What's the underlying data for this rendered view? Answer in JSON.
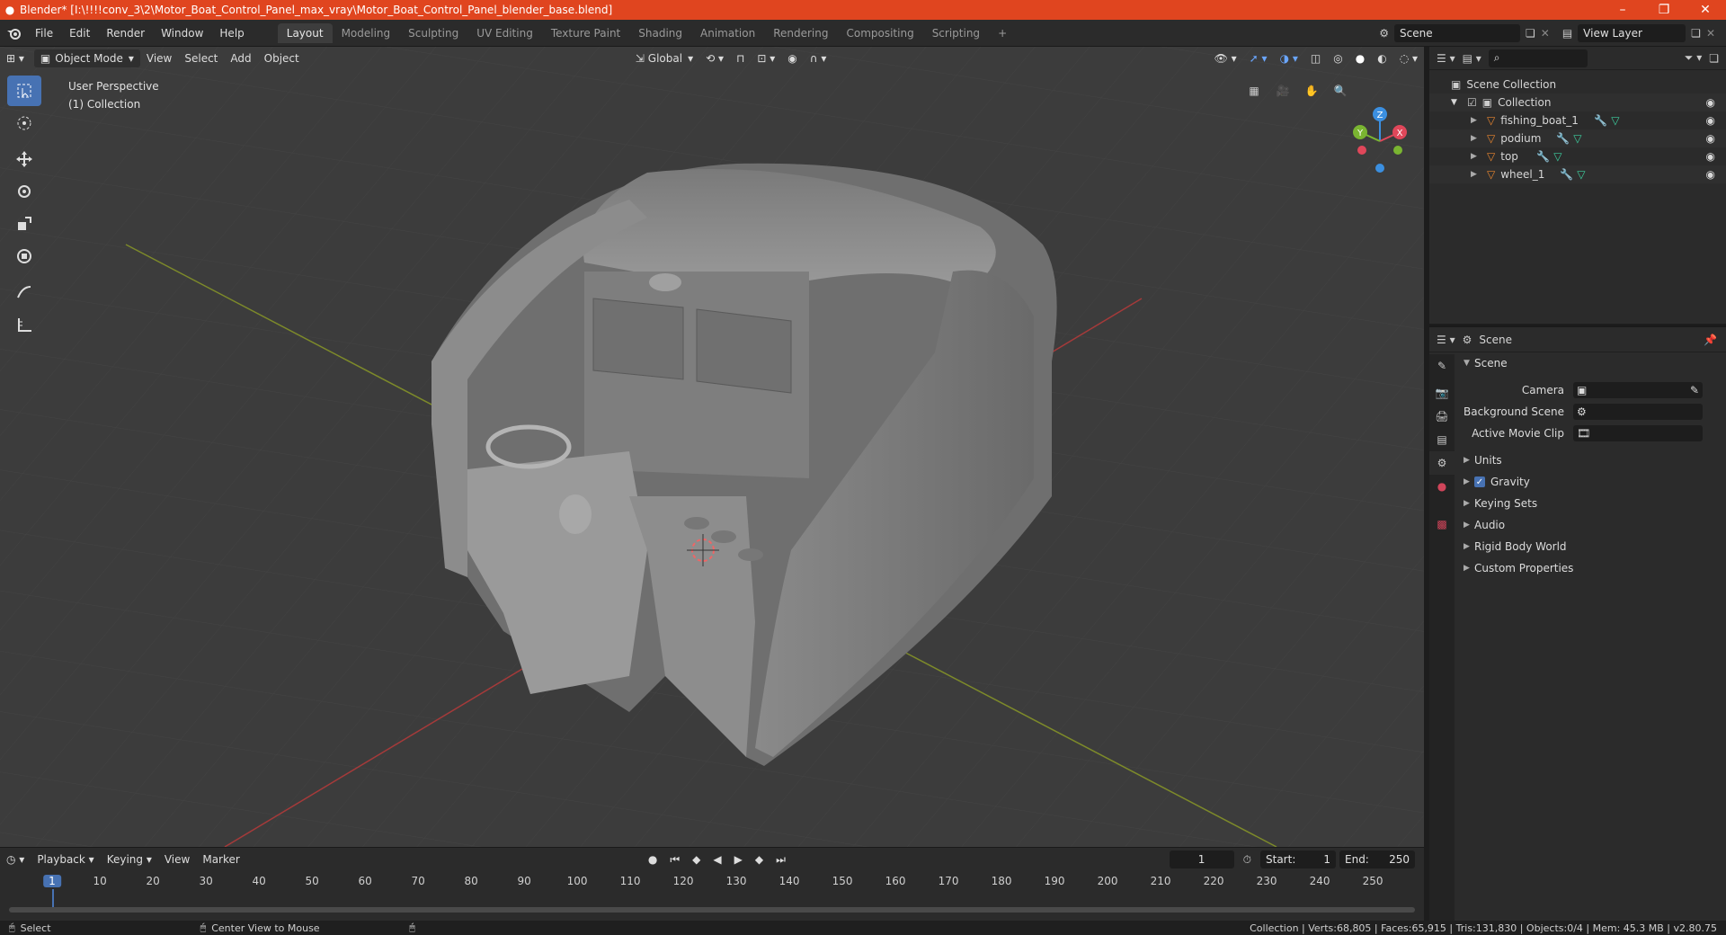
{
  "window": {
    "title": "Blender* [I:\\!!!!conv_3\\2\\Motor_Boat_Control_Panel_max_vray\\Motor_Boat_Control_Panel_blender_base.blend]",
    "minimize": "–",
    "maximize": "❐",
    "close": "✕"
  },
  "menus": [
    "File",
    "Edit",
    "Render",
    "Window",
    "Help"
  ],
  "workspaces": [
    "Layout",
    "Modeling",
    "Sculpting",
    "UV Editing",
    "Texture Paint",
    "Shading",
    "Animation",
    "Rendering",
    "Compositing",
    "Scripting"
  ],
  "workspace_add": "+",
  "scene_selector": {
    "value": "Scene"
  },
  "view_layer_selector": {
    "value": "View Layer"
  },
  "viewport": {
    "mode": "Object Mode",
    "menus": [
      "View",
      "Select",
      "Add",
      "Object"
    ],
    "orientation": "Global",
    "info_line1": "User Perspective",
    "info_line2": "(1) Collection",
    "gizmo": {
      "x": "X",
      "y": "Y",
      "z": "Z"
    }
  },
  "outliner": {
    "scene_collection": "Scene Collection",
    "collection": "Collection",
    "objects": [
      "fishing_boat_1",
      "podium",
      "top",
      "wheel_1"
    ]
  },
  "properties": {
    "header_title": "Scene",
    "panel_title": "Scene",
    "fields": [
      {
        "label": "Camera",
        "value": ""
      },
      {
        "label": "Background Scene",
        "value": ""
      },
      {
        "label": "Active Movie Clip",
        "value": ""
      }
    ],
    "panels": [
      "Units",
      "Gravity",
      "Keying Sets",
      "Audio",
      "Rigid Body World",
      "Custom Properties"
    ]
  },
  "timeline": {
    "menus": [
      "Playback",
      "Keying",
      "View",
      "Marker"
    ],
    "current_frame": "1",
    "start_label": "Start:",
    "start_value": "1",
    "end_label": "End:",
    "end_value": "250",
    "ticks": [
      "1",
      "10",
      "20",
      "30",
      "40",
      "50",
      "60",
      "70",
      "80",
      "90",
      "100",
      "110",
      "120",
      "130",
      "140",
      "150",
      "160",
      "170",
      "180",
      "190",
      "200",
      "210",
      "220",
      "230",
      "240",
      "250"
    ]
  },
  "statusbar": {
    "left1": "Select",
    "left2": "Center View to Mouse",
    "right": "Collection | Verts:68,805 | Faces:65,915 | Tris:131,830 | Objects:0/4 | Mem: 45.3 MB | v2.80.75"
  },
  "colors": {
    "titlebar": "#e0451f",
    "accent": "#4772b3",
    "object_orange": "#e8852f",
    "modifier_blue": "#5c9cf0",
    "mesh_green": "#3dd0a0"
  }
}
